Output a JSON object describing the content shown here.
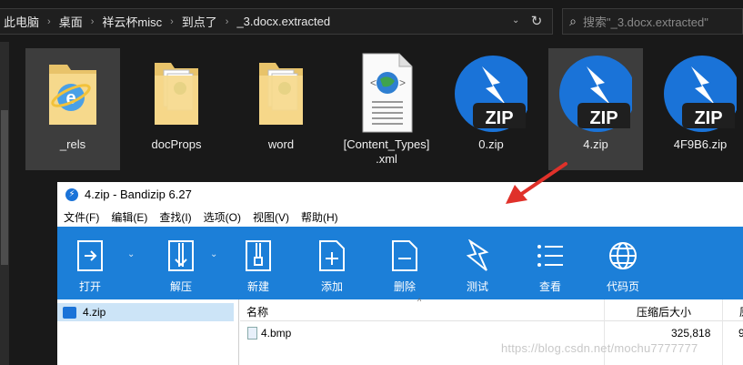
{
  "explorer": {
    "breadcrumb": [
      "此电脑",
      "桌面",
      "祥云杯misc",
      "到点了",
      "_3.docx.extracted"
    ],
    "search_placeholder": "搜索\"_3.docx.extracted\"",
    "items": [
      {
        "label": "_rels",
        "icon": "ie-folder-icon",
        "selected": true
      },
      {
        "label": "docProps",
        "icon": "folder-icon",
        "selected": false
      },
      {
        "label": "word",
        "icon": "folder-icon",
        "selected": false
      },
      {
        "label": "[Content_Types]\n.xml",
        "icon": "xml-file-icon",
        "selected": false
      },
      {
        "label": "0.zip",
        "icon": "bandizip-zip-icon",
        "selected": false
      },
      {
        "label": "4.zip",
        "icon": "bandizip-zip-icon",
        "selected": true
      },
      {
        "label": "4F9B6.zip",
        "icon": "bandizip-zip-icon",
        "selected": false
      }
    ],
    "zip_badge": "ZIP"
  },
  "bandizip": {
    "title": "4.zip - Bandizip 6.27",
    "menu": [
      "文件(F)",
      "编辑(E)",
      "查找(I)",
      "选项(O)",
      "视图(V)",
      "帮助(H)"
    ],
    "toolbar": [
      "打开",
      "解压",
      "新建",
      "添加",
      "删除",
      "测试",
      "查看",
      "代码页"
    ],
    "sidebar_item": "4.zip",
    "columns": {
      "name": "名称",
      "compressed": "压缩后大小",
      "extra": "原"
    },
    "files": [
      {
        "name": "4.bmp",
        "compressed_size": "325,818",
        "extra": "9"
      }
    ]
  },
  "watermark": "https://blog.csdn.net/mochu7777777",
  "colors": {
    "toolbar_blue": "#1c7fd8",
    "zip_blue": "#1a73d8",
    "arrow_red": "#e0312a"
  }
}
